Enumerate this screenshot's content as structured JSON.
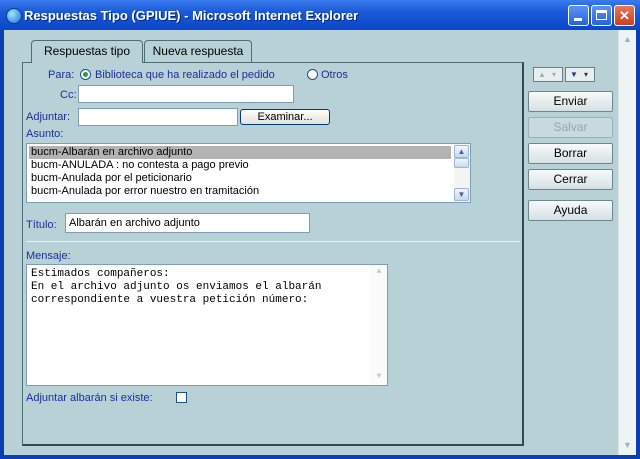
{
  "window": {
    "title": "Respuestas Tipo (GPIUE) - Microsoft Internet Explorer"
  },
  "tabs": [
    {
      "label": "Respuestas tipo",
      "active": true
    },
    {
      "label": "Nueva respuesta",
      "active": false
    }
  ],
  "form": {
    "para_label": "Para:",
    "para_options": [
      {
        "label": "Biblioteca que ha realizado el pedido",
        "selected": true
      },
      {
        "label": "Otros",
        "selected": false
      }
    ],
    "cc_label": "Cc:",
    "cc_value": "",
    "adjuntar_label": "Adjuntar:",
    "adjuntar_value": "",
    "examinar_label": "Examinar...",
    "asunto_label": "Asunto:",
    "asunto_items": [
      {
        "label": "bucm-Albarán en archivo adjunto",
        "selected": true
      },
      {
        "label": "bucm-ANULADA : no contesta a pago previo",
        "selected": false
      },
      {
        "label": "bucm-Anulada por el peticionario",
        "selected": false
      },
      {
        "label": "bucm-Anulada por error nuestro en tramitación",
        "selected": false
      }
    ],
    "titulo_label": "Título:",
    "titulo_value": "Albarán en archivo adjunto",
    "mensaje_label": "Mensaje:",
    "mensaje_lines": [
      "Estimados compañeros:",
      "En el archivo adjunto os enviamos el albarán",
      "correspondiente a vuestra petición número:"
    ],
    "adjuntar_albaran_label": "Adjuntar albarán si existe:",
    "adjuntar_albaran_checked": false
  },
  "actions": {
    "enviar": "Enviar",
    "salvar": "Salvar",
    "borrar": "Borrar",
    "cerrar": "Cerrar",
    "ayuda": "Ayuda"
  },
  "colors": {
    "label_blue": "#1b2f9a",
    "background": "#b7d1d7",
    "titlebar": "#0a47c9"
  }
}
